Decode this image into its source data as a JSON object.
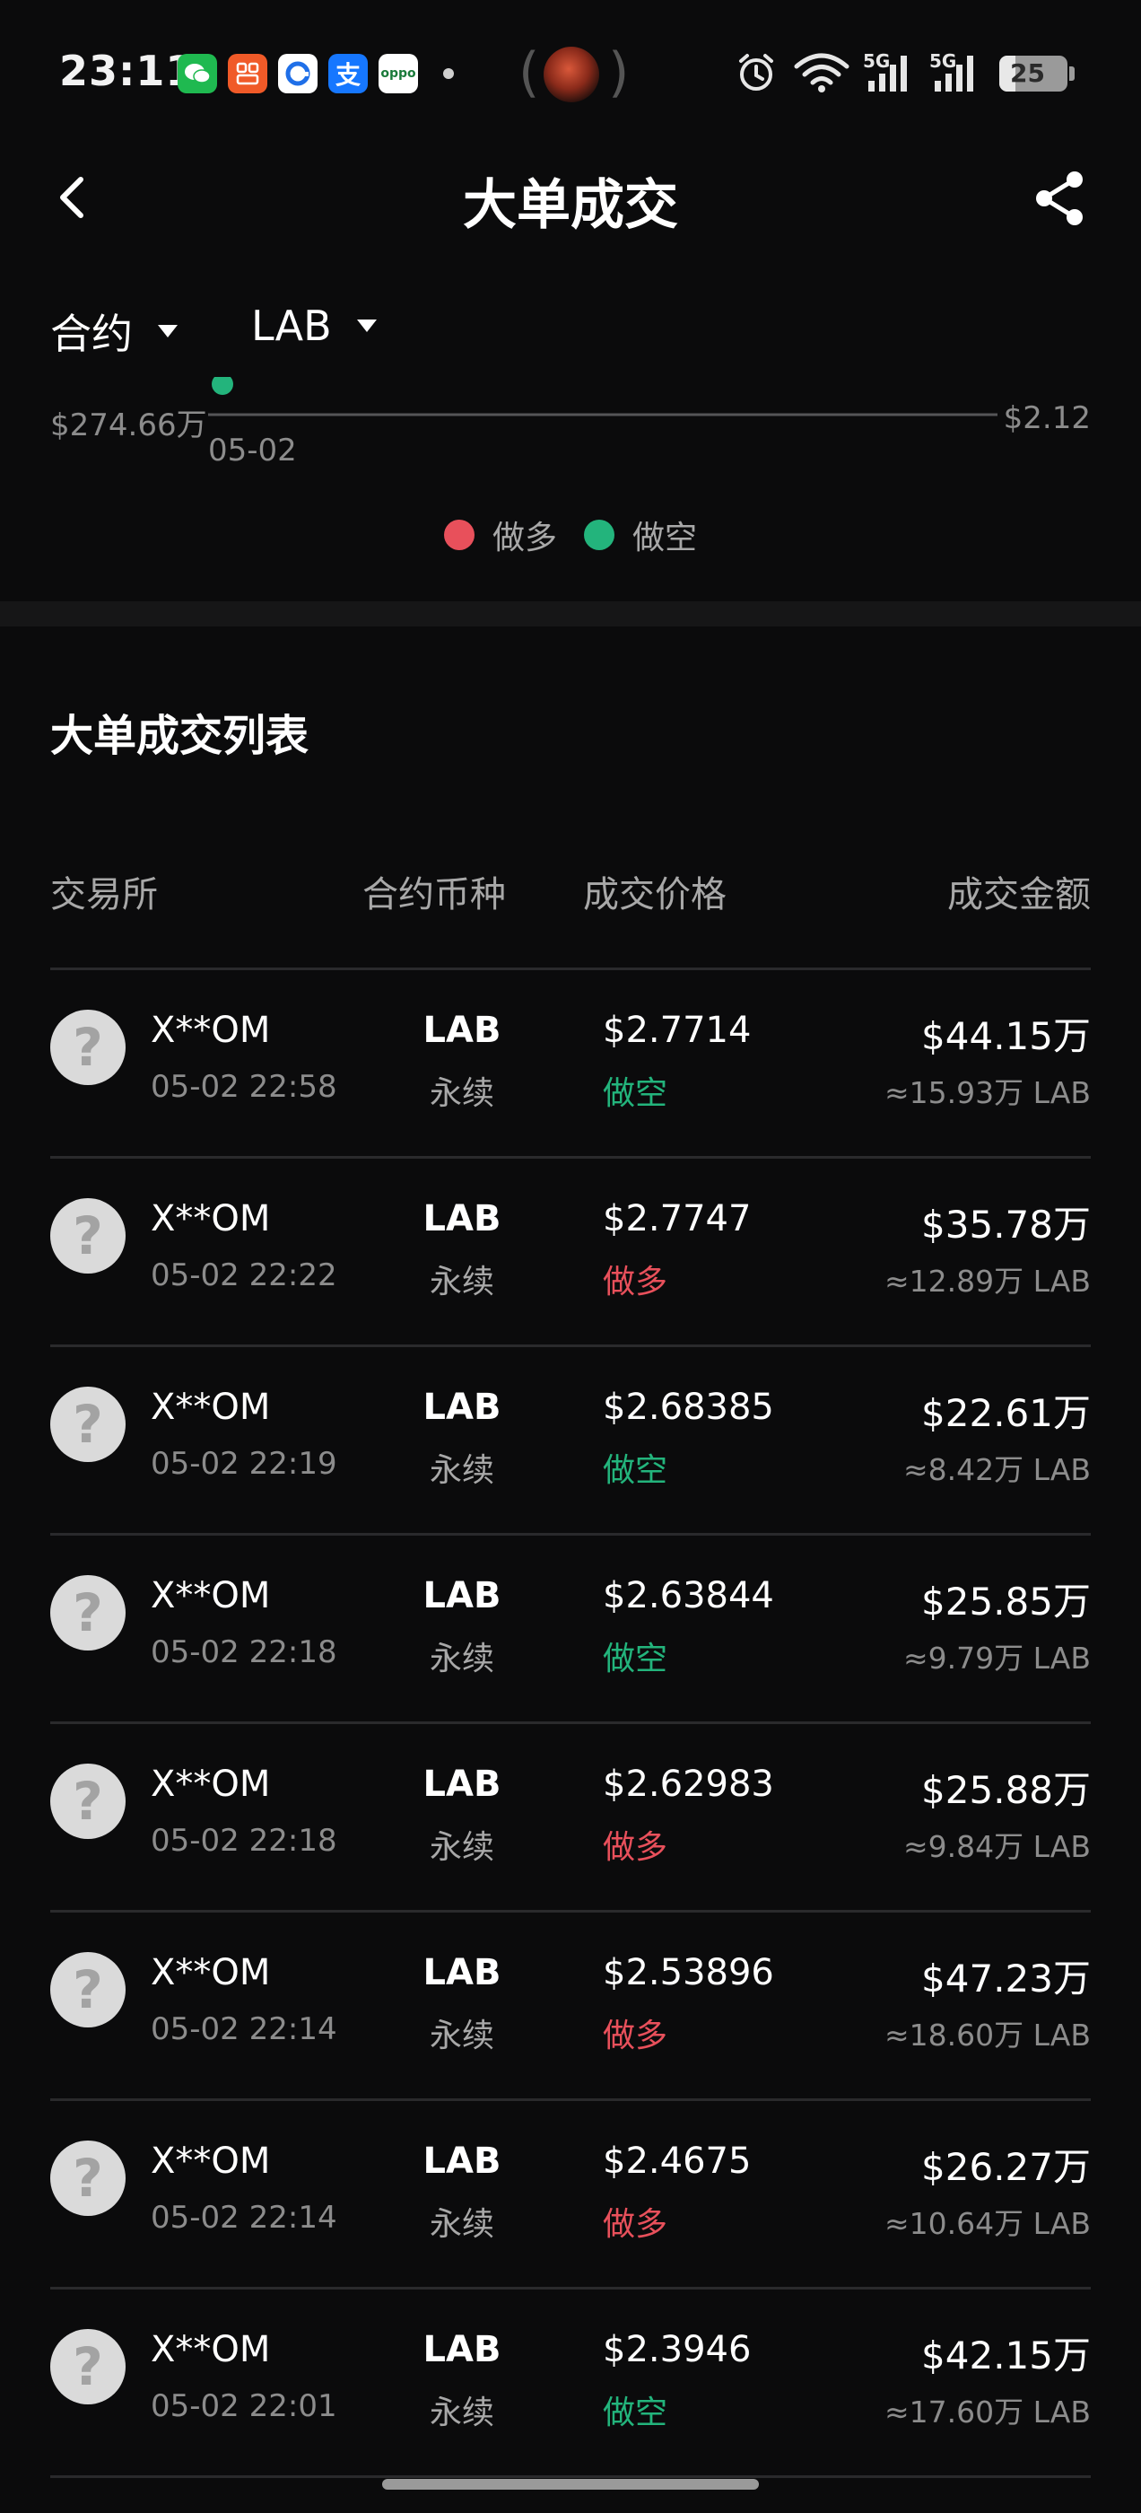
{
  "status_bar": {
    "time": "23:11",
    "battery": "25",
    "signal_label_1": "5G",
    "signal_label_2": "5G"
  },
  "header": {
    "title": "大单成交"
  },
  "filters": {
    "contract": "合约",
    "coin": "LAB"
  },
  "chart": {
    "y_left_label": "$274.66万",
    "y_right_label": "$2.12",
    "x_label": "05-02",
    "legend": [
      {
        "label": "做多",
        "color": "#e8505b"
      },
      {
        "label": "做空",
        "color": "#23b47c"
      }
    ]
  },
  "list": {
    "title": "大单成交列表",
    "columns": {
      "exchange": "交易所",
      "coin": "合约币种",
      "price": "成交价格",
      "amount": "成交金额"
    },
    "rows": [
      {
        "exchange": "X**OM",
        "time": "05-02 22:58",
        "coin": "LAB",
        "type": "永续",
        "price": "$2.7714",
        "side": "做空",
        "side_color": "#23b47c",
        "amount": "$44.15万",
        "qty": "≈15.93万 LAB"
      },
      {
        "exchange": "X**OM",
        "time": "05-02 22:22",
        "coin": "LAB",
        "type": "永续",
        "price": "$2.7747",
        "side": "做多",
        "side_color": "#e8505b",
        "amount": "$35.78万",
        "qty": "≈12.89万 LAB"
      },
      {
        "exchange": "X**OM",
        "time": "05-02 22:19",
        "coin": "LAB",
        "type": "永续",
        "price": "$2.68385",
        "side": "做空",
        "side_color": "#23b47c",
        "amount": "$22.61万",
        "qty": "≈8.42万 LAB"
      },
      {
        "exchange": "X**OM",
        "time": "05-02 22:18",
        "coin": "LAB",
        "type": "永续",
        "price": "$2.63844",
        "side": "做空",
        "side_color": "#23b47c",
        "amount": "$25.85万",
        "qty": "≈9.79万 LAB"
      },
      {
        "exchange": "X**OM",
        "time": "05-02 22:18",
        "coin": "LAB",
        "type": "永续",
        "price": "$2.62983",
        "side": "做多",
        "side_color": "#e8505b",
        "amount": "$25.88万",
        "qty": "≈9.84万 LAB"
      },
      {
        "exchange": "X**OM",
        "time": "05-02 22:14",
        "coin": "LAB",
        "type": "永续",
        "price": "$2.53896",
        "side": "做多",
        "side_color": "#e8505b",
        "amount": "$47.23万",
        "qty": "≈18.60万 LAB"
      },
      {
        "exchange": "X**OM",
        "time": "05-02 22:14",
        "coin": "LAB",
        "type": "永续",
        "price": "$2.4675",
        "side": "做多",
        "side_color": "#e8505b",
        "amount": "$26.27万",
        "qty": "≈10.64万 LAB"
      },
      {
        "exchange": "X**OM",
        "time": "05-02 22:01",
        "coin": "LAB",
        "type": "永续",
        "price": "$2.3946",
        "side": "做空",
        "side_color": "#23b47c",
        "amount": "$42.15万",
        "qty": "≈17.60万 LAB"
      }
    ]
  }
}
